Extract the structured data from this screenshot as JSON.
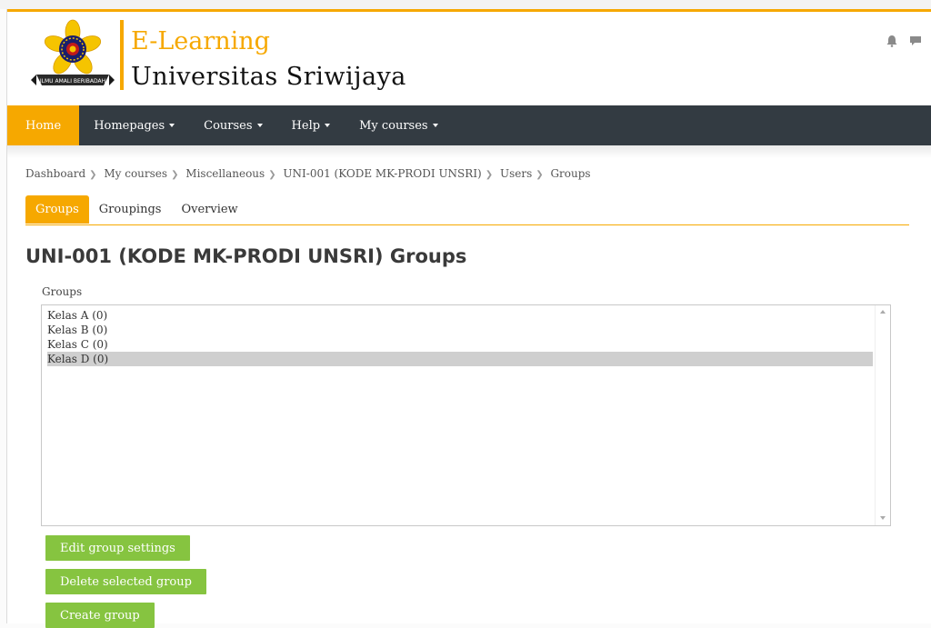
{
  "header": {
    "brand_line1": "E-Learning",
    "brand_line2": "Universitas  Sriwijaya",
    "logo_icon": "university-emblem-icon",
    "logo_text": "ILMU AMALI BERIBADAH",
    "notification_icon": "bell-icon",
    "messages_icon": "chat-icon"
  },
  "navbar": {
    "items": [
      {
        "label": "Home",
        "dropdown": false,
        "active": true
      },
      {
        "label": "Homepages",
        "dropdown": true
      },
      {
        "label": "Courses",
        "dropdown": true
      },
      {
        "label": "Help",
        "dropdown": true
      },
      {
        "label": "My courses",
        "dropdown": true
      }
    ]
  },
  "breadcrumb": [
    "Dashboard",
    "My courses",
    "Miscellaneous",
    "UNI-001 (KODE MK-PRODI UNSRI)",
    "Users",
    "Groups"
  ],
  "tabs": [
    {
      "label": "Groups",
      "active": true
    },
    {
      "label": "Groupings"
    },
    {
      "label": "Overview"
    }
  ],
  "main": {
    "title": "UNI-001 (KODE MK-PRODI UNSRI) Groups",
    "groups_label": "Groups",
    "groups": [
      {
        "label": "Kelas A (0)"
      },
      {
        "label": "Kelas B (0)"
      },
      {
        "label": "Kelas C (0)"
      },
      {
        "label": "Kelas D (0)",
        "selected": true
      }
    ],
    "buttons": {
      "edit": "Edit group settings",
      "delete": "Delete selected group",
      "create": "Create group"
    }
  },
  "colors": {
    "accent": "#f6a800",
    "navbar": "#333b42",
    "button": "#86c440"
  }
}
